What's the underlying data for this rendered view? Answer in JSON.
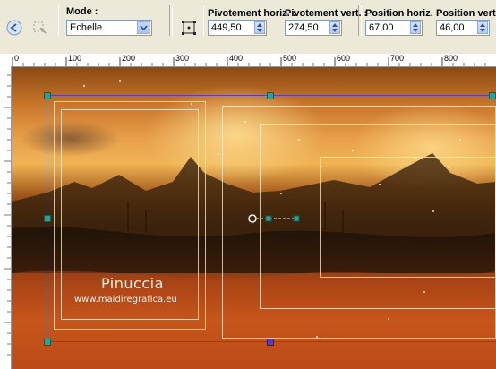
{
  "toolbar": {
    "mode_label": "Mode :",
    "mode_value": "Echelle",
    "pivot_h_label": "Pivotement horiz. :",
    "pivot_h_value": "449,50",
    "pivot_v_label": "Pivotement vert. :",
    "pivot_v_value": "274,50",
    "pos_h_label": "Position horiz. :",
    "pos_h_value": "67,00",
    "pos_v_label": "Position vert. :",
    "pos_v_value": "46,00"
  },
  "ruler": {
    "ticks": [
      "0",
      "100",
      "200",
      "300",
      "400",
      "500",
      "600",
      "700",
      "800"
    ]
  },
  "canvas": {
    "watermark_name": "Pinuccia",
    "watermark_url": "www.maidiregrafica.eu"
  },
  "colors": {
    "handle": "#2f9f8f",
    "selection": "#5b3fb0",
    "accent": "#3a4f9e"
  }
}
